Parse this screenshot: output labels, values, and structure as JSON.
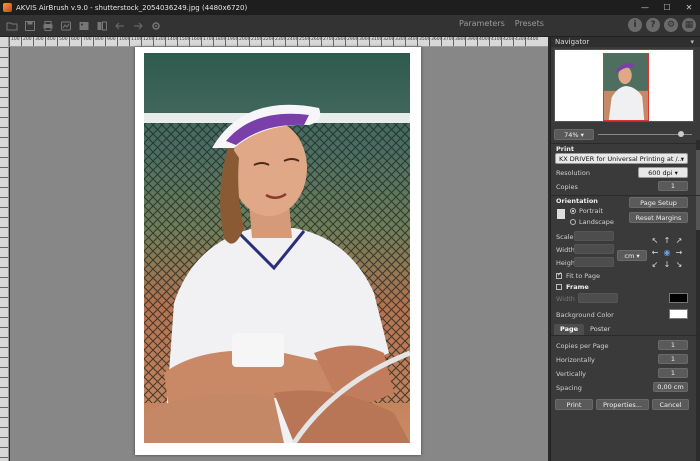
{
  "window": {
    "title": "AKVIS AirBrush v.9.0 - shutterstock_2054036249.jpg (4480x6720)",
    "min_glyph": "—",
    "max_glyph": "☐",
    "close_glyph": "✕"
  },
  "toolbar": {
    "tools": [
      "open-icon",
      "save-icon",
      "print-icon",
      "share-icon",
      "photo-icon",
      "compare-icon",
      "undo-icon",
      "redo-icon",
      "settings-icon"
    ],
    "tabs": [
      "Parameters",
      "Presets"
    ],
    "right_icons": {
      "info": "i",
      "help": "?",
      "prefs": "⚙",
      "gallery": "▦"
    }
  },
  "ruler": {
    "ticks": [
      "100",
      "200",
      "300",
      "400",
      "500",
      "600",
      "700",
      "800",
      "900",
      "1000",
      "1100",
      "1200",
      "1300",
      "1400",
      "1500",
      "1600",
      "1700",
      "1800",
      "1900",
      "2000",
      "2100",
      "2200",
      "2300",
      "2400",
      "2500",
      "2600",
      "2700",
      "2800",
      "2900",
      "3000",
      "3100",
      "3200",
      "3300",
      "3400",
      "3500",
      "3600",
      "3700",
      "3800",
      "3900",
      "4000",
      "4100",
      "4200",
      "4300",
      "4400"
    ]
  },
  "navigator": {
    "title": "Navigator",
    "zoom": "74%",
    "zoom_slider_fraction": 0.88
  },
  "print": {
    "section_title": "Print",
    "printer": "KX DRIVER for Universal Printing at /...",
    "resolution_label": "Resolution",
    "resolution": "600 dpi",
    "copies_label": "Copies",
    "copies": "1",
    "orientation_label": "Orientation",
    "portrait": "Portrait",
    "landscape": "Landscape",
    "page_setup": "Page Setup",
    "reset_margins": "Reset Margins",
    "scale_label": "Scale",
    "width_label": "Width",
    "height_label": "Height",
    "unit": "cm",
    "fit_to_page": "Fit to Page",
    "frame_label": "Frame",
    "frame_width_label": "Width",
    "background_label": "Background Color",
    "frame_color": "#000000",
    "background_color": "#ffffff"
  },
  "page_tabs": {
    "tabs": [
      "Page",
      "Poster"
    ],
    "copies_per_page_label": "Copies per Page",
    "copies_per_page": "1",
    "horizontally_label": "Horizontally",
    "horizontally": "1",
    "vertically_label": "Vertically",
    "vertically": "1",
    "spacing_label": "Spacing",
    "spacing": "0,00 cm"
  },
  "actions": {
    "print": "Print",
    "properties": "Properties...",
    "cancel": "Cancel"
  }
}
